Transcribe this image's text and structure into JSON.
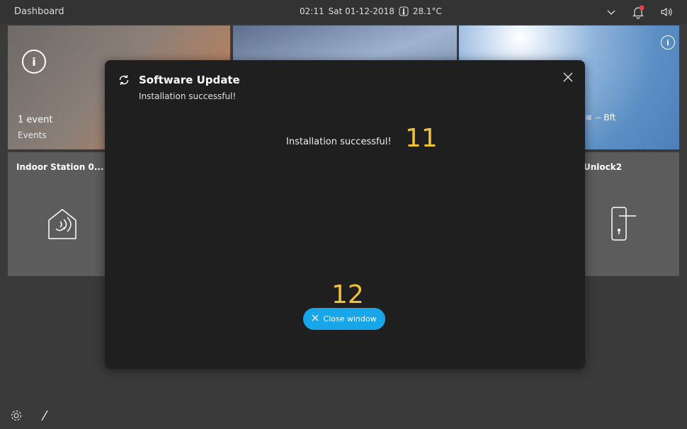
{
  "topbar": {
    "title": "Dashboard",
    "time": "02:11",
    "date": "Sat 01-12-2018",
    "temperature": "28.1°C",
    "icons": [
      "chevron-down-icon",
      "bell-icon",
      "speaker-icon"
    ],
    "notification_color": "#e8414e"
  },
  "tiles": {
    "events": {
      "count": "1 event",
      "sub": "Events",
      "icon": "info-icon"
    },
    "weather": {
      "wind": "-- Bft",
      "icon": "info-icon"
    },
    "indoor_station": {
      "label": "Indoor Station 0...",
      "icon": "indoor-station-icon"
    },
    "unlock": {
      "label": "Unlock2",
      "icon": "door-handle-icon"
    }
  },
  "bottom_bar": {
    "icons": [
      "settings-icon",
      "edit-icon"
    ]
  },
  "modal": {
    "title": "Software Update",
    "subtitle": "Installation successful!",
    "message": "Installation successful!",
    "close_button_label": "Close window",
    "accent_color": "#17a6ea"
  },
  "annotations": {
    "message_marker": "11",
    "button_marker": "12",
    "color": "#f0c23a"
  }
}
